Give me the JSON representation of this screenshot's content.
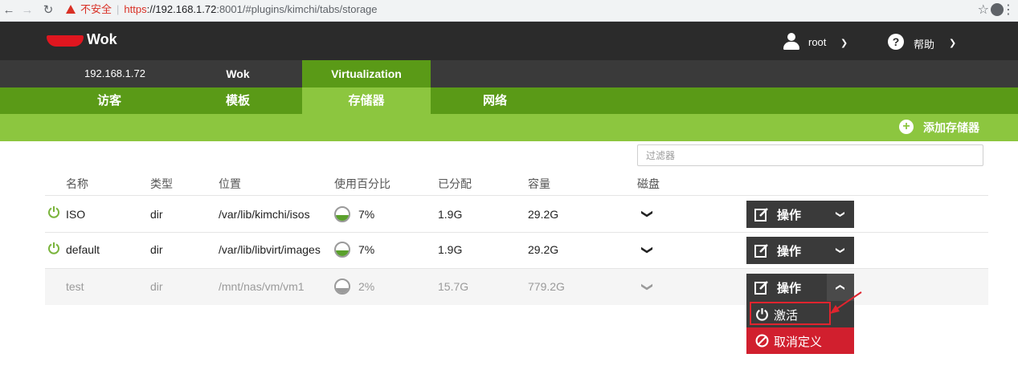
{
  "browser": {
    "insecure_label": "不安全",
    "url_scheme": "https",
    "url_host": "://192.168.1.72",
    "url_path": ":8001/#plugins/kimchi/tabs/storage"
  },
  "header": {
    "app_name": "Wok",
    "user": "root",
    "help": "帮助"
  },
  "host_tabs": [
    "192.168.1.72",
    "Wok",
    "Virtualization"
  ],
  "sub_tabs": [
    "访客",
    "模板",
    "存储器",
    "网络"
  ],
  "actions": {
    "add_storage": "添加存储器"
  },
  "filter": {
    "placeholder": "过滤器"
  },
  "table": {
    "headers": {
      "name": "名称",
      "type": "类型",
      "location": "位置",
      "usage": "使用百分比",
      "allocated": "已分配",
      "capacity": "容量",
      "disk": "磁盘"
    },
    "rows": [
      {
        "name": "ISO",
        "type": "dir",
        "location": "/var/lib/kimchi/isos",
        "usage": "7%",
        "allocated": "1.9G",
        "capacity": "29.2G",
        "active": true
      },
      {
        "name": "default",
        "type": "dir",
        "location": "/var/lib/libvirt/images",
        "usage": "7%",
        "allocated": "1.9G",
        "capacity": "29.2G",
        "active": true
      },
      {
        "name": "test",
        "type": "dir",
        "location": "/mnt/nas/vm/vm1",
        "usage": "2%",
        "allocated": "15.7G",
        "capacity": "779.2G",
        "active": false
      }
    ]
  },
  "row_action_label": "操作",
  "menu": {
    "activate": "激活",
    "undefine": "取消定义"
  },
  "colors": {
    "header_dark": "#2b2b2b",
    "green_dark": "#5a9a17",
    "green_light": "#8cc63f",
    "danger": "#d11f2e"
  }
}
